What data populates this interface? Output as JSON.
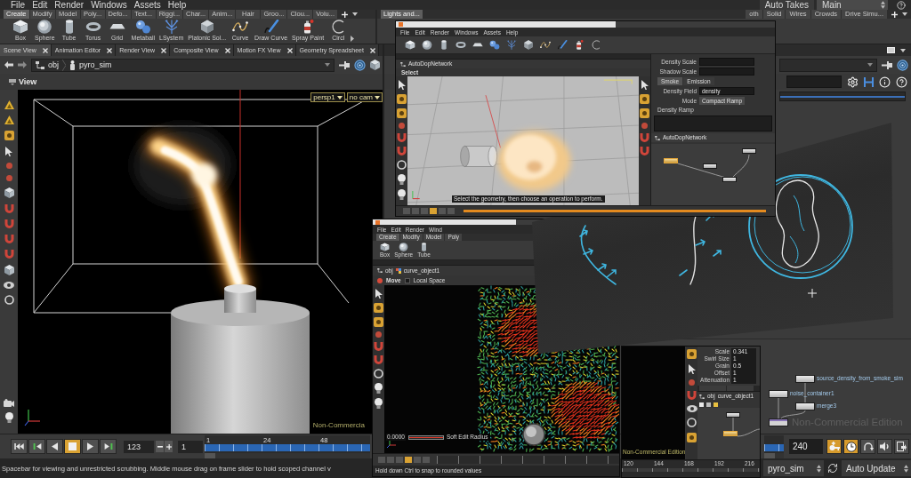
{
  "menu": [
    "File",
    "Edit",
    "Render",
    "Windows",
    "Assets",
    "Help"
  ],
  "takes": {
    "label": "Auto Takes",
    "current": "Main"
  },
  "shelf": {
    "tabs": [
      {
        "label": "Create",
        "selected": true
      },
      {
        "label": "Modify",
        "selected": false
      },
      {
        "label": "Model",
        "selected": false
      },
      {
        "label": "Poly...",
        "selected": false
      },
      {
        "label": "Defo...",
        "selected": false
      },
      {
        "label": "Text...",
        "selected": false
      },
      {
        "label": "Riggi...",
        "selected": false
      },
      {
        "label": "Char...",
        "selected": false
      },
      {
        "label": "Anim...",
        "selected": false
      },
      {
        "label": "Hair",
        "selected": false
      },
      {
        "label": "Groo...",
        "selected": false
      },
      {
        "label": "Clou...",
        "selected": false
      },
      {
        "label": "Volu...",
        "selected": false
      }
    ],
    "tools": [
      {
        "label": "Box",
        "kind": "box"
      },
      {
        "label": "Sphere",
        "kind": "sphere"
      },
      {
        "label": "Tube",
        "kind": "tube"
      },
      {
        "label": "Torus",
        "kind": "torus"
      },
      {
        "label": "Grid",
        "kind": "grid"
      },
      {
        "label": "Metaball",
        "kind": "metaball"
      },
      {
        "label": "LSystem",
        "kind": "lsystem"
      },
      {
        "label": "Platonic Sol...",
        "kind": "platonic"
      },
      {
        "label": "Curve",
        "kind": "curve"
      },
      {
        "label": "Draw Curve",
        "kind": "drawcurve"
      },
      {
        "label": "Spray Paint",
        "kind": "spray"
      },
      {
        "label": "Circl",
        "kind": "circle"
      }
    ]
  },
  "shelf_right": {
    "tabs_start": [
      {
        "label": "Lights and...",
        "selected": true
      }
    ],
    "tabs_end": [
      {
        "label": "oth",
        "selected": false
      },
      {
        "label": "Solid",
        "selected": false
      },
      {
        "label": "Wires",
        "selected": false
      },
      {
        "label": "Crowds",
        "selected": false
      },
      {
        "label": "Drive Simu...",
        "selected": false
      }
    ]
  },
  "scene_view": {
    "tabs": [
      {
        "label": "Scene View",
        "selected": true
      },
      {
        "label": "Animation Editor",
        "selected": false
      },
      {
        "label": "Render View",
        "selected": false
      },
      {
        "label": "Composite View",
        "selected": false
      },
      {
        "label": "Motion FX View",
        "selected": false
      },
      {
        "label": "Geometry Spreadsheet",
        "selected": false
      }
    ],
    "path": [
      "obj",
      "pyro_sim"
    ],
    "title": "View",
    "camera": "persp1",
    "camera_mode": "no cam",
    "watermark": "Non-Commercia"
  },
  "network": {
    "nodes": [
      {
        "label": "source_density_from_smoke_sim",
        "kind": "sop"
      },
      {
        "label": "noise_container1",
        "kind": "sop"
      },
      {
        "label": "merge3",
        "kind": "sop"
      },
      {
        "kind": "dop"
      }
    ],
    "watermark": "Non-Commercial Edition"
  },
  "playbar": {
    "buttons": [
      {
        "kind": "first",
        "selected": false
      },
      {
        "kind": "prev_key",
        "selected": false
      },
      {
        "kind": "reverse",
        "selected": false
      },
      {
        "kind": "stop",
        "selected": true
      },
      {
        "kind": "play",
        "selected": false
      },
      {
        "kind": "next_key",
        "selected": false
      }
    ],
    "frame": "123",
    "start": "1",
    "ticks": [
      "1",
      "24",
      "48"
    ],
    "end": "240",
    "toggles": [
      {
        "kind": "key",
        "on": true
      },
      {
        "kind": "realtime",
        "on": true
      },
      {
        "kind": "loop",
        "on": false
      },
      {
        "kind": "audio",
        "on": false
      },
      {
        "kind": "export",
        "on": false
      }
    ]
  },
  "status": {
    "message": "Spacebar for viewing and unrestricted scrubbing. Middle mouse drag on frame slider to hold scoped channel v",
    "object": "pyro_sim",
    "update": "Auto Update"
  },
  "inset_pyro": {
    "menu": [
      "File",
      "Edit",
      "Render",
      "Windows",
      "Assets",
      "Help"
    ],
    "path": "AutoDopNetwork",
    "view_title": "Select",
    "prompt": "Select the geometry, then choose an operation to perform.",
    "params": [
      {
        "label": "Density Scale"
      },
      {
        "label": "Shadow Scale"
      }
    ],
    "tabs": [
      {
        "label": "Smoke",
        "selected": true
      },
      {
        "label": "Emission",
        "selected": false
      }
    ],
    "fields": [
      {
        "label": "Density Field",
        "value": "density"
      },
      {
        "label": "Mode",
        "value": "Compact Ramp"
      }
    ],
    "ramp_label": "Density Ramp",
    "network_path": "AutoDopNetwork"
  },
  "inset_field": {
    "menu": [
      "File",
      "Edit",
      "Render",
      "Wind"
    ],
    "tabs": [
      {
        "label": "Create",
        "selected": true
      },
      {
        "label": "Modify",
        "selected": false
      },
      {
        "label": "Model",
        "selected": false
      },
      {
        "label": "Poly",
        "selected": false
      }
    ],
    "tools": [
      {
        "label": "Box",
        "kind": "box"
      },
      {
        "label": "Sphere",
        "kind": "sphere"
      },
      {
        "label": "Tube",
        "kind": "tube"
      }
    ],
    "path": [
      "obj",
      "curve_object1"
    ],
    "tool": "Move",
    "local_space": {
      "label": "Local Space",
      "checked": false
    },
    "radius": {
      "value": "0.0000",
      "label": "Soft Edit Radius",
      "level": 1
    },
    "status": "Hold down Ctrl to snap to rounded values"
  },
  "inset_network": {
    "params": [
      {
        "label": "Scale",
        "value": "0.341"
      },
      {
        "label": "Swirl Size",
        "value": "1"
      },
      {
        "label": "Grain",
        "value": "0.5"
      },
      {
        "label": "Offset",
        "value": "1"
      },
      {
        "label": "Attenuation",
        "value": "1"
      }
    ],
    "path": [
      "obj",
      "curve_object1"
    ],
    "nodes": [
      {
        "selected": false
      },
      {
        "selected": true
      }
    ],
    "watermark": "Non-Commercial Edition",
    "ticks": [
      "120",
      "144",
      "168",
      "192",
      "216"
    ]
  }
}
